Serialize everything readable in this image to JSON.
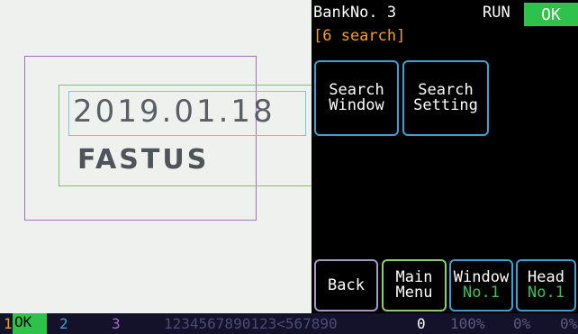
{
  "camera_view": {
    "printed_date": "2019.01.18",
    "printed_text": "FASTUS"
  },
  "header": {
    "bank": "BankNo. 3",
    "run_status": "RUN",
    "result": "OK",
    "mode": "[6 search]"
  },
  "buttons": {
    "search_window": [
      "Search",
      "Window"
    ],
    "search_setting": [
      "Search",
      "Setting"
    ],
    "back": "Back",
    "main_menu": [
      "Main",
      "Menu"
    ],
    "window": [
      "Window",
      "No.1"
    ],
    "head": [
      "Head",
      "No.1"
    ]
  },
  "status_bar": {
    "tool1_index": "1",
    "tool1_result": "OK",
    "tool2_index": "2",
    "tool3_index": "3",
    "read_string": "1234567890123<567890",
    "count": "0",
    "pct1": "100%",
    "pct2": "0%",
    "pct3": "0%"
  },
  "colors": {
    "ok_green": "#2ec24a",
    "accent_orange": "#f0a020",
    "button_blue": "#3aa0d8"
  }
}
